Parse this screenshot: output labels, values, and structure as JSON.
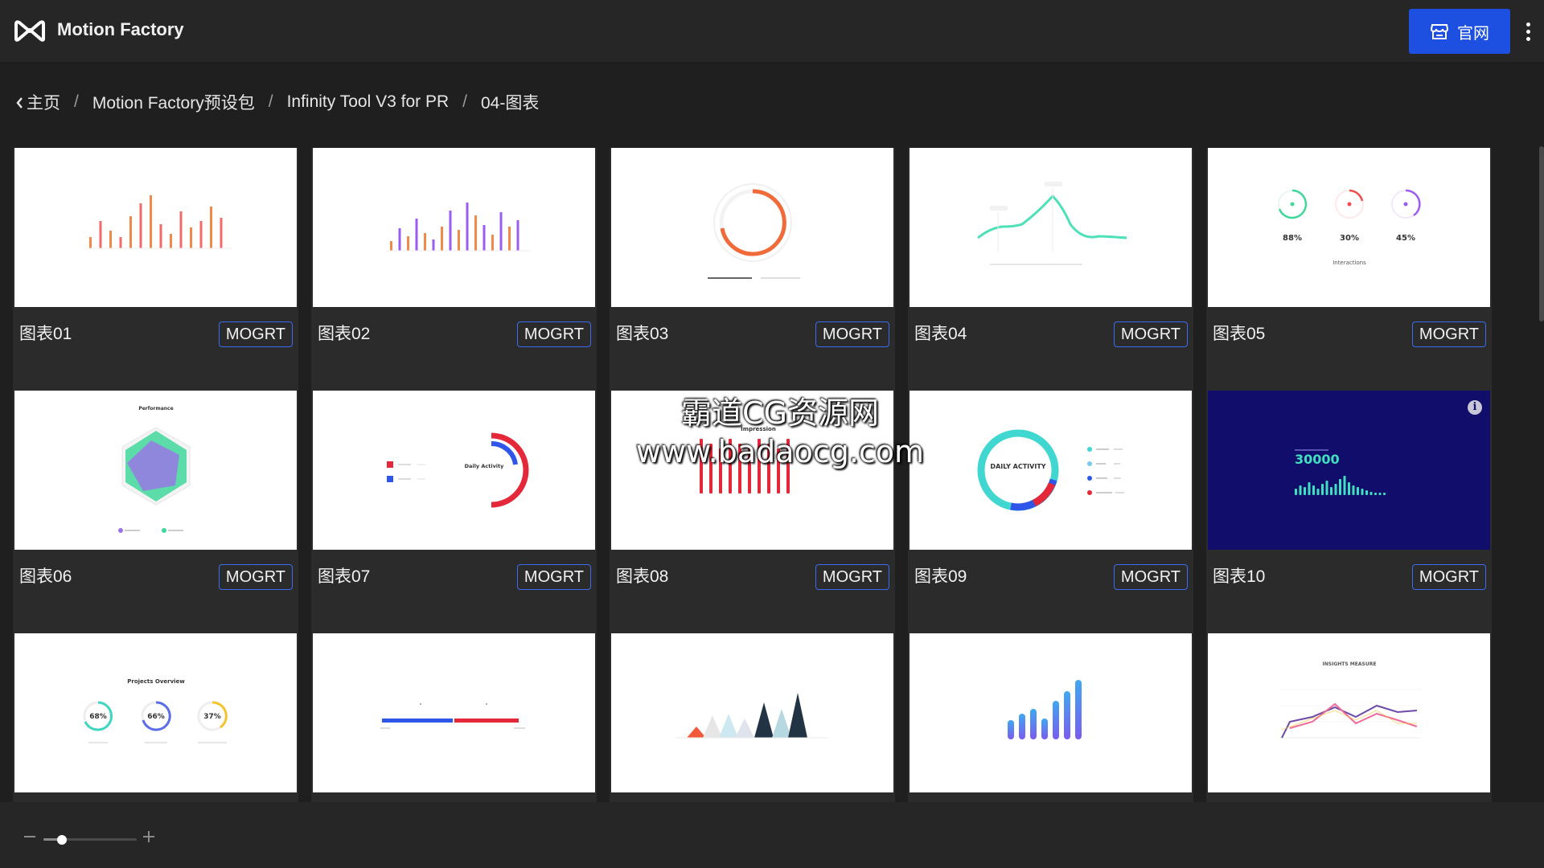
{
  "app": {
    "title": "Motion Factory",
    "official_button": "官网"
  },
  "breadcrumb": [
    "主页",
    "Motion Factory预设包",
    "Infinity Tool V3 for PR",
    "04-图表"
  ],
  "cards": [
    {
      "title": "图表01",
      "tag": "MOGRT"
    },
    {
      "title": "图表02",
      "tag": "MOGRT"
    },
    {
      "title": "图表03",
      "tag": "MOGRT"
    },
    {
      "title": "图表04",
      "tag": "MOGRT"
    },
    {
      "title": "图表05",
      "tag": "MOGRT"
    },
    {
      "title": "图表06",
      "tag": "MOGRT"
    },
    {
      "title": "图表07",
      "tag": "MOGRT"
    },
    {
      "title": "图表08",
      "tag": "MOGRT"
    },
    {
      "title": "图表09",
      "tag": "MOGRT"
    },
    {
      "title": "图表10",
      "tag": "MOGRT"
    }
  ],
  "thumbs": {
    "t5_values": [
      "88%",
      "30%",
      "45%"
    ],
    "t5_label": "Interactions",
    "t6_title": "Performance",
    "t7_label": "Daily Activity",
    "t8_title": "Impression",
    "t9_label": "DAILY ACTIVITY",
    "t10_value": "30000",
    "t11_title": "Projects Overview",
    "t11_values": [
      "68%",
      "66%",
      "37%"
    ],
    "t15_title": "INSIGHTS MEASURE"
  },
  "watermark": {
    "line1": "霸道CG资源网",
    "line2": "www.badaocg.com"
  },
  "zoom": {
    "level": 0.2
  },
  "colors": {
    "accent": "#1d4fe0",
    "tag_border": "#3b6cf0"
  }
}
